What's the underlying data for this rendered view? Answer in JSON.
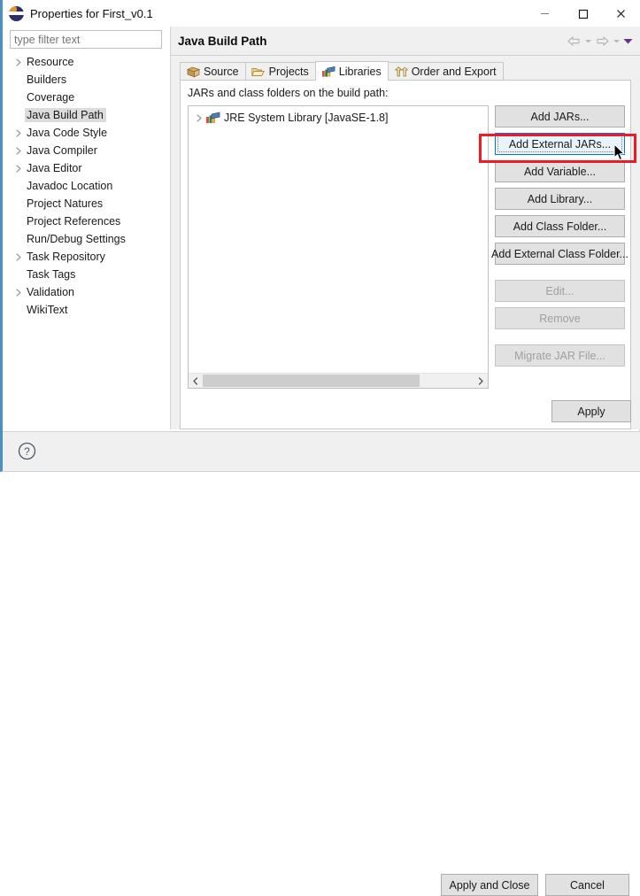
{
  "window": {
    "title": "Properties for First_v0.1",
    "icon": "eclipse-logo-icon",
    "controls": {
      "minimize": "minimize-icon",
      "maximize": "maximize-icon",
      "close": "close-icon"
    }
  },
  "filter": {
    "placeholder": "type filter text",
    "value": ""
  },
  "sidebar": {
    "items": [
      {
        "label": "Resource",
        "expandable": true,
        "selected": false
      },
      {
        "label": "Builders",
        "expandable": false,
        "selected": false
      },
      {
        "label": "Coverage",
        "expandable": false,
        "selected": false
      },
      {
        "label": "Java Build Path",
        "expandable": false,
        "selected": true
      },
      {
        "label": "Java Code Style",
        "expandable": true,
        "selected": false
      },
      {
        "label": "Java Compiler",
        "expandable": true,
        "selected": false
      },
      {
        "label": "Java Editor",
        "expandable": true,
        "selected": false
      },
      {
        "label": "Javadoc Location",
        "expandable": false,
        "selected": false
      },
      {
        "label": "Project Natures",
        "expandable": false,
        "selected": false
      },
      {
        "label": "Project References",
        "expandable": false,
        "selected": false
      },
      {
        "label": "Run/Debug Settings",
        "expandable": false,
        "selected": false
      },
      {
        "label": "Task Repository",
        "expandable": true,
        "selected": false
      },
      {
        "label": "Task Tags",
        "expandable": false,
        "selected": false
      },
      {
        "label": "Validation",
        "expandable": true,
        "selected": false
      },
      {
        "label": "WikiText",
        "expandable": false,
        "selected": false
      }
    ]
  },
  "main": {
    "page_title": "Java Build Path",
    "nav": {
      "back": "back-arrow-icon",
      "back_menu": "chevron-down-icon",
      "forward": "forward-arrow-icon",
      "forward_menu": "chevron-down-icon",
      "menu": "view-menu-icon"
    },
    "tabs": [
      {
        "label": "Source",
        "icon": "source-folder-icon",
        "active": false
      },
      {
        "label": "Projects",
        "icon": "open-folder-icon",
        "active": false
      },
      {
        "label": "Libraries",
        "icon": "libraries-books-icon",
        "active": true
      },
      {
        "label": "Order and Export",
        "icon": "order-export-arrows-icon",
        "active": false
      }
    ],
    "list_caption": "JARs and class folders on the build path:",
    "classpath_entries": [
      {
        "label": "JRE System Library [JavaSE-1.8]",
        "icon": "libraries-books-icon",
        "expandable": true
      }
    ],
    "scrollbar": {
      "left_arrow": "chevron-left-icon",
      "right_arrow": "chevron-right-icon",
      "thumb_percent": 80
    },
    "buttons": [
      {
        "label": "Add JARs...",
        "state": "enabled"
      },
      {
        "label": "Add External JARs...",
        "state": "focused"
      },
      {
        "label": "Add Variable...",
        "state": "enabled"
      },
      {
        "label": "Add Library...",
        "state": "enabled"
      },
      {
        "label": "Add Class Folder...",
        "state": "enabled"
      },
      {
        "label": "Add External Class Folder...",
        "state": "enabled"
      },
      {
        "label": "Edit...",
        "state": "disabled"
      },
      {
        "label": "Remove",
        "state": "disabled"
      },
      {
        "label": "Migrate JAR File...",
        "state": "disabled"
      }
    ],
    "apply_label": "Apply"
  },
  "footer": {
    "help": "help-question-icon",
    "apply_and_close": "Apply and Close",
    "cancel": "Cancel"
  },
  "annotation": {
    "highlight_target": "Add External JARs...",
    "highlight_color": "#ed1c24"
  },
  "colors": {
    "accent": "#0078d7",
    "dialog_border": "#4a90c7",
    "panel_bg": "#f0f0f0",
    "button_bg": "#e1e1e1",
    "selection_bg": "#dcdcdc",
    "annotation_red": "#ed1c24"
  }
}
